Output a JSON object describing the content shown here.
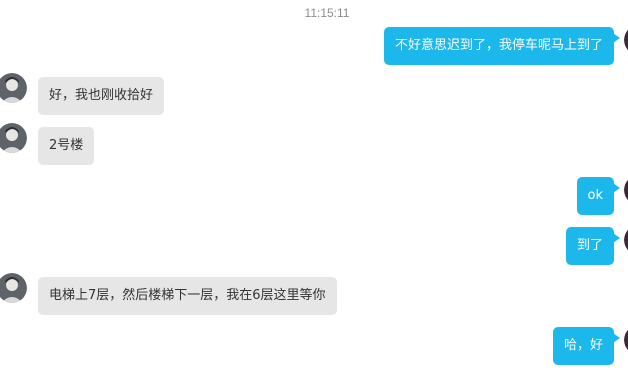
{
  "timestamp": "11:15:11",
  "colors": {
    "outgoing_bubble": "#1cb8ec",
    "incoming_bubble": "#e6e6e6"
  },
  "messages": [
    {
      "direction": "outgoing",
      "text": "不好意思迟到了，我停车呢马上到了",
      "avatar": "user-avatar"
    },
    {
      "direction": "incoming",
      "text": "好，我也刚收拾好",
      "avatar": "contact-avatar"
    },
    {
      "direction": "incoming",
      "text": "2号楼",
      "avatar": "contact-avatar"
    },
    {
      "direction": "outgoing",
      "text": "ok",
      "avatar": "user-avatar"
    },
    {
      "direction": "outgoing",
      "text": "到了",
      "avatar": "user-avatar"
    },
    {
      "direction": "incoming",
      "text": "电梯上7层，然后楼梯下一层，我在6层这里等你",
      "avatar": "contact-avatar"
    },
    {
      "direction": "outgoing",
      "text": "哈，好",
      "avatar": "user-avatar"
    }
  ]
}
